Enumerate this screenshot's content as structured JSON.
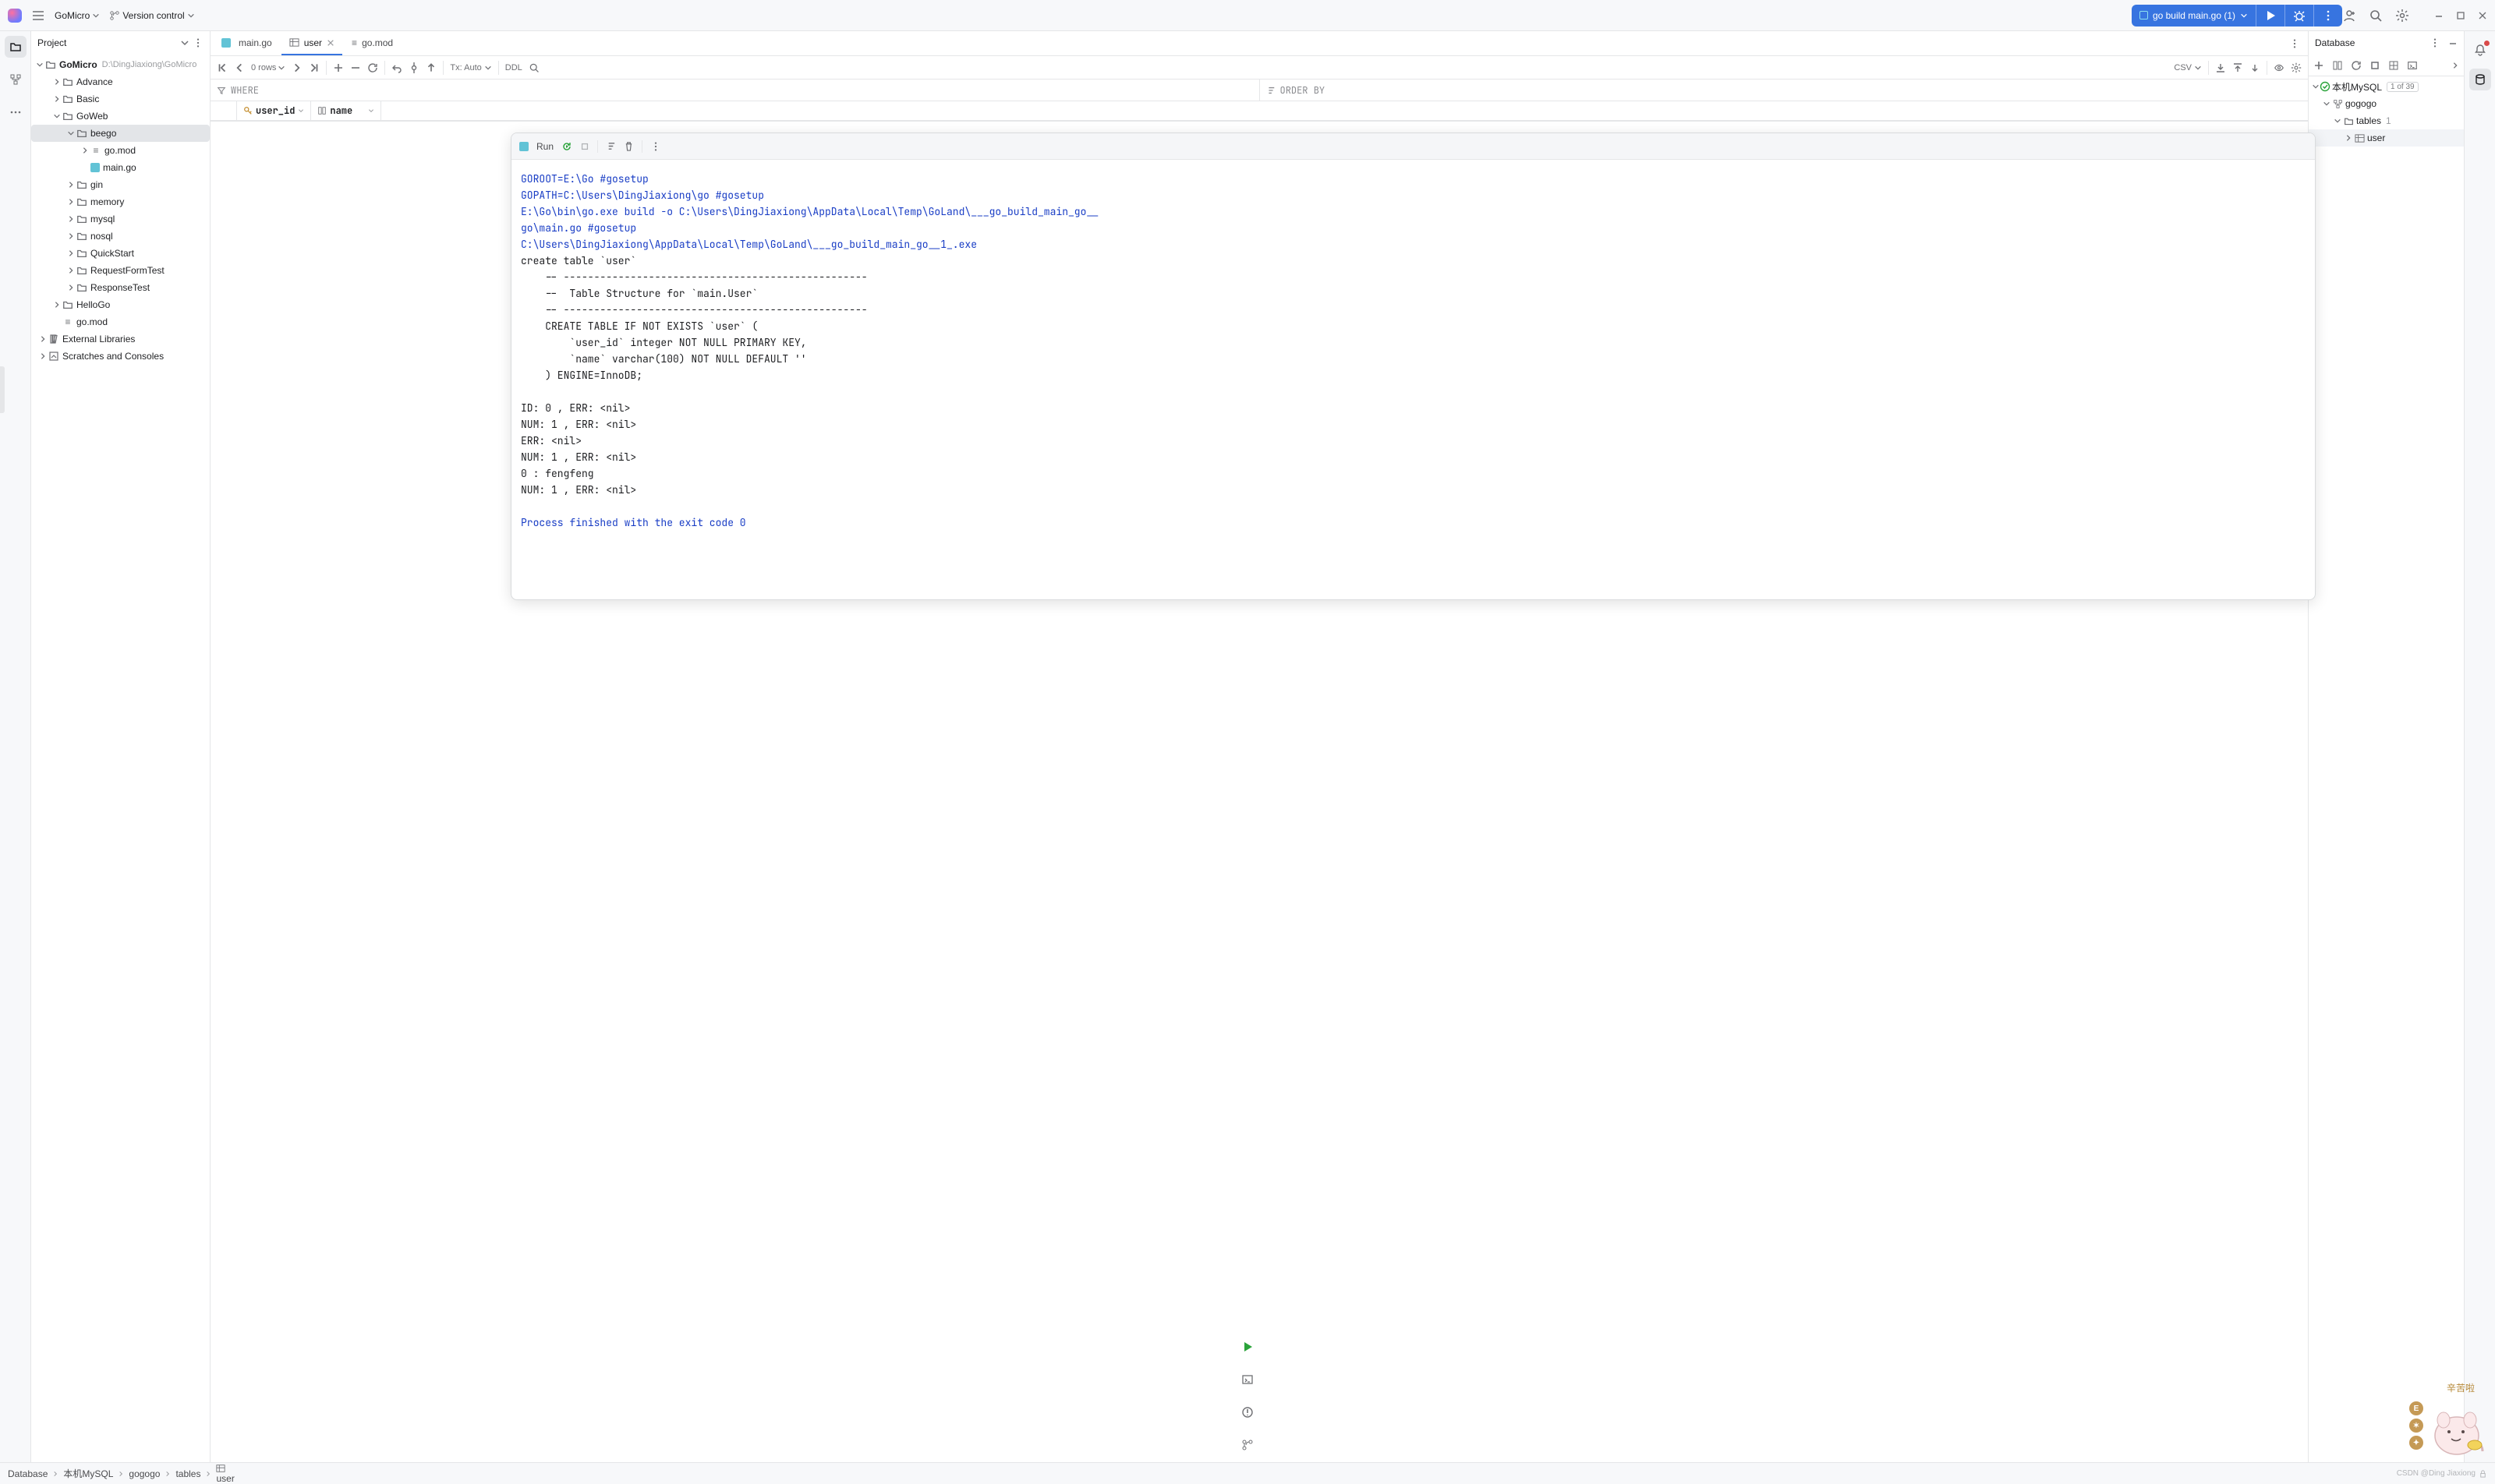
{
  "top": {
    "project": "GoMicro",
    "vcs": "Version control",
    "run_config": "go build main.go (1)"
  },
  "strip_left": [
    "folder",
    "structure",
    "more"
  ],
  "project_panel": {
    "title": "Project",
    "root": {
      "name": "GoMicro",
      "path": "D:\\DingJiaxiong\\GoMicro"
    },
    "tree": [
      {
        "indent": 1,
        "caret": "right",
        "icon": "folder",
        "name": "Advance"
      },
      {
        "indent": 1,
        "caret": "right",
        "icon": "folder",
        "name": "Basic"
      },
      {
        "indent": 1,
        "caret": "down",
        "icon": "folder",
        "name": "GoWeb"
      },
      {
        "indent": 2,
        "caret": "down",
        "icon": "folder",
        "name": "beego",
        "sel": true
      },
      {
        "indent": 3,
        "caret": "right",
        "icon": "gomod",
        "name": "go.mod"
      },
      {
        "indent": 3,
        "caret": "",
        "icon": "go",
        "name": "main.go"
      },
      {
        "indent": 2,
        "caret": "right",
        "icon": "folder",
        "name": "gin"
      },
      {
        "indent": 2,
        "caret": "right",
        "icon": "folder",
        "name": "memory"
      },
      {
        "indent": 2,
        "caret": "right",
        "icon": "folder",
        "name": "mysql"
      },
      {
        "indent": 2,
        "caret": "right",
        "icon": "folder",
        "name": "nosql"
      },
      {
        "indent": 2,
        "caret": "right",
        "icon": "folder",
        "name": "QuickStart"
      },
      {
        "indent": 2,
        "caret": "right",
        "icon": "folder",
        "name": "RequestFormTest"
      },
      {
        "indent": 2,
        "caret": "right",
        "icon": "folder",
        "name": "ResponseTest"
      },
      {
        "indent": 1,
        "caret": "right",
        "icon": "folder",
        "name": "HelloGo"
      },
      {
        "indent": 1,
        "caret": "",
        "icon": "gomod",
        "name": "go.mod"
      },
      {
        "indent": 0,
        "caret": "right",
        "icon": "lib",
        "name": "External Libraries"
      },
      {
        "indent": 0,
        "caret": "right",
        "icon": "scratch",
        "name": "Scratches and Consoles"
      }
    ]
  },
  "tabs": [
    {
      "icon": "go",
      "name": "main.go",
      "active": false
    },
    {
      "icon": "table",
      "name": "user",
      "active": true
    },
    {
      "icon": "gomod",
      "name": "go.mod",
      "active": false
    }
  ],
  "grid": {
    "rows_label": "0 rows",
    "tx_label": "Tx: Auto",
    "ddl_label": "DDL",
    "export_label": "CSV",
    "where": "WHERE",
    "order_by": "ORDER BY",
    "columns": [
      {
        "key": true,
        "name": "user_id"
      },
      {
        "key": false,
        "name": "name"
      }
    ]
  },
  "db_panel": {
    "title": "Database",
    "conn": "本机MySQL",
    "conn_count": "1 of 39",
    "schema": "gogogo",
    "tables_label": "tables",
    "tables_count": "1",
    "table": "user"
  },
  "run": {
    "title": "Run",
    "lines": [
      {
        "cls": "setup",
        "t": "GOROOT=E:\\Go #gosetup"
      },
      {
        "cls": "setup",
        "t": "GOPATH=C:\\Users\\DingJiaxiong\\go #gosetup"
      },
      {
        "cls": "setup",
        "t": "E:\\Go\\bin\\go.exe build -o C:\\Users\\DingJiaxiong\\AppData\\Local\\Temp\\GoLand\\___go_build_main_go__"
      },
      {
        "cls": "setup",
        "t": "go\\main.go #gosetup"
      },
      {
        "cls": "setup",
        "t": "C:\\Users\\DingJiaxiong\\AppData\\Local\\Temp\\GoLand\\___go_build_main_go__1_.exe"
      },
      {
        "cls": "normal",
        "t": "create table `user` "
      },
      {
        "cls": "normal",
        "t": "    -- --------------------------------------------------"
      },
      {
        "cls": "normal",
        "t": "    --  Table Structure for `main.User`"
      },
      {
        "cls": "normal",
        "t": "    -- --------------------------------------------------"
      },
      {
        "cls": "normal",
        "t": "    CREATE TABLE IF NOT EXISTS `user` ("
      },
      {
        "cls": "normal",
        "t": "        `user_id` integer NOT NULL PRIMARY KEY,"
      },
      {
        "cls": "normal",
        "t": "        `name` varchar(100) NOT NULL DEFAULT '' "
      },
      {
        "cls": "normal",
        "t": "    ) ENGINE=InnoDB;"
      },
      {
        "cls": "normal",
        "t": ""
      },
      {
        "cls": "normal",
        "t": "ID: 0 , ERR: <nil>"
      },
      {
        "cls": "normal",
        "t": "NUM: 1 , ERR: <nil>"
      },
      {
        "cls": "normal",
        "t": "ERR: <nil>"
      },
      {
        "cls": "normal",
        "t": "NUM: 1 , ERR: <nil>"
      },
      {
        "cls": "normal",
        "t": "0 : fengfeng"
      },
      {
        "cls": "normal",
        "t": "NUM: 1 , ERR: <nil>"
      },
      {
        "cls": "normal",
        "t": ""
      },
      {
        "cls": "exit",
        "t": "Process finished with the exit code 0"
      }
    ]
  },
  "breadcrumb": [
    "Database",
    "本机MySQL",
    "gogogo",
    "tables",
    "user"
  ],
  "watermark": "CSDN @Ding Jiaxiong",
  "mascot_text": "辛苦啦"
}
